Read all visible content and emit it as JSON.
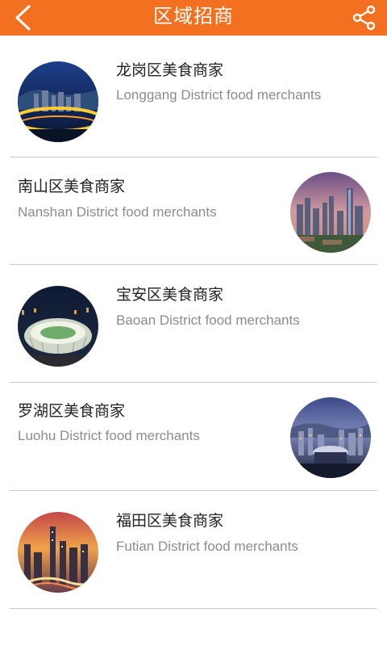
{
  "header": {
    "title": "区域招商",
    "back_icon": "chevron-left-icon",
    "share_icon": "share-icon",
    "background": "#f37021"
  },
  "merchants": [
    {
      "title": "龙岗区美食商家",
      "subtitle": "Longgang District food merchants",
      "image_side": "left",
      "image": "longgang-night-city-photo"
    },
    {
      "title": "南山区美食商家",
      "subtitle": "Nanshan District food merchants",
      "image_side": "right",
      "image": "nanshan-skyline-photo"
    },
    {
      "title": "宝安区美食商家",
      "subtitle": "Baoan District food merchants",
      "image_side": "left",
      "image": "baoan-stadium-photo"
    },
    {
      "title": "罗湖区美食商家",
      "subtitle": "Luohu District food merchants",
      "image_side": "right",
      "image": "luohu-city-photo"
    },
    {
      "title": "福田区美食商家",
      "subtitle": "Futian District food merchants",
      "image_side": "left",
      "image": "futian-sunset-photo"
    }
  ]
}
